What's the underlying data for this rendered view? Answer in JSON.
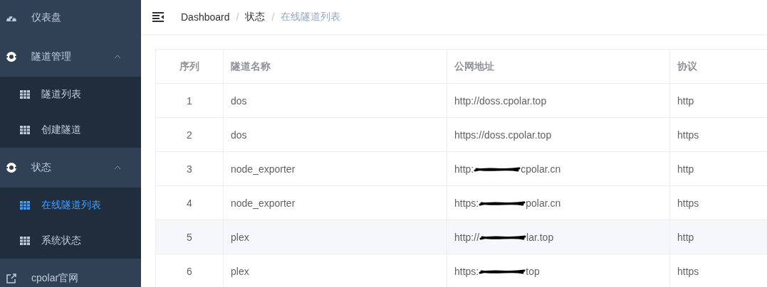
{
  "sidebar": {
    "items": [
      {
        "kind": "home",
        "label": "仪表盘"
      },
      {
        "kind": "group",
        "label": "隧道管理",
        "expanded": true,
        "children": [
          {
            "label": "隧道列表",
            "selected": false
          },
          {
            "label": "创建隧道",
            "selected": false
          }
        ]
      },
      {
        "kind": "group",
        "label": "状态",
        "expanded": true,
        "children": [
          {
            "label": "在线隧道列表",
            "selected": true
          },
          {
            "label": "系统状态",
            "selected": false
          }
        ]
      },
      {
        "kind": "external",
        "label": "cpolar官网"
      }
    ]
  },
  "breadcrumb": [
    {
      "label": "Dashboard",
      "current": false
    },
    {
      "label": "状态",
      "current": false
    },
    {
      "label": "在线隧道列表",
      "current": true
    }
  ],
  "breadcrumb_separator": "/",
  "table": {
    "columns": [
      "序列",
      "隧道名称",
      "公网地址",
      "协议"
    ],
    "rows": [
      {
        "index": "1",
        "name": "dos",
        "address": [
          "http://doss.cpolar.top"
        ],
        "redacted": false,
        "protocol": "http",
        "highlighted": false
      },
      {
        "index": "2",
        "name": "dos",
        "address": [
          "https://doss.cpolar.top"
        ],
        "redacted": false,
        "protocol": "https",
        "highlighted": false
      },
      {
        "index": "3",
        "name": "node_exporter",
        "address": [
          "http:",
          "cpolar.cn"
        ],
        "redacted": true,
        "protocol": "http",
        "highlighted": false
      },
      {
        "index": "4",
        "name": "node_exporter",
        "address": [
          "https:",
          "polar.cn"
        ],
        "redacted": true,
        "protocol": "https",
        "highlighted": false
      },
      {
        "index": "5",
        "name": "plex",
        "address": [
          "http://",
          "lar.top"
        ],
        "redacted": true,
        "protocol": "http",
        "highlighted": true
      },
      {
        "index": "6",
        "name": "plex",
        "address": [
          "https:",
          "top"
        ],
        "redacted": true,
        "protocol": "https",
        "highlighted": false
      }
    ]
  }
}
